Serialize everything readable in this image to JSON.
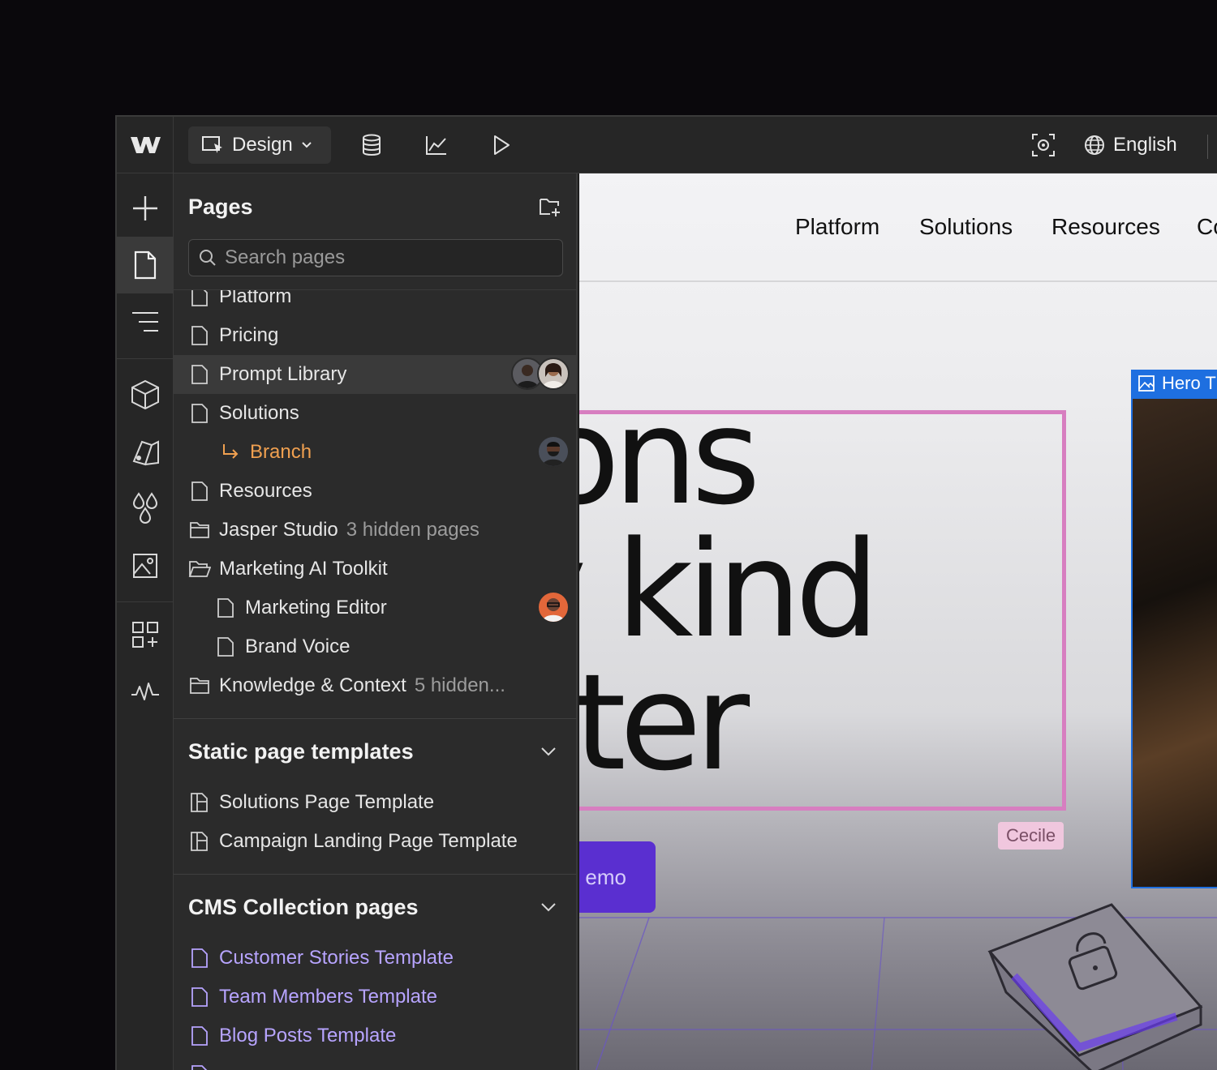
{
  "topbar": {
    "mode_label": "Design",
    "language_label": "English"
  },
  "rail": {
    "items": [
      "add-icon",
      "pages-icon",
      "navigator-icon",
      "components-icon",
      "style-selector-icon",
      "variables-icon",
      "assets-icon",
      "apps-icon",
      "audit-icon"
    ]
  },
  "pages_panel": {
    "title": "Pages",
    "search_placeholder": "Search pages",
    "items": [
      {
        "label": "Platform",
        "icon": "page-icon"
      },
      {
        "label": "Pricing",
        "icon": "page-icon"
      },
      {
        "label": "Prompt Library",
        "icon": "page-icon",
        "highlighted": true
      },
      {
        "label": "Solutions",
        "icon": "page-icon"
      },
      {
        "label": "Branch",
        "icon": "branch-icon"
      },
      {
        "label": "Resources",
        "icon": "page-icon"
      },
      {
        "label": "Jasper Studio",
        "meta": "3 hidden pages",
        "icon": "folder-icon"
      },
      {
        "label": "Marketing AI Toolkit",
        "icon": "folder-open-icon"
      },
      {
        "label": "Marketing Editor",
        "icon": "page-icon"
      },
      {
        "label": "Brand Voice",
        "icon": "page-icon"
      },
      {
        "label": "Knowledge & Context",
        "meta": "5 hidden...",
        "icon": "folder-icon"
      }
    ]
  },
  "static_templates": {
    "title": "Static page templates",
    "items": [
      "Solutions Page Template",
      "Campaign Landing Page Template"
    ]
  },
  "cms_pages": {
    "title": "CMS Collection pages",
    "items": [
      "Customer Stories Template",
      "Team Members Template",
      "Blog Posts Template"
    ]
  },
  "canvas": {
    "nav_links": [
      "Platform",
      "Solutions",
      "Resources",
      "Co"
    ],
    "hero_text": "utions\nery kind\nrketer",
    "cursor_label": "Cecile",
    "cta_label": "emo",
    "image_label": "Hero T"
  },
  "colors": {
    "accent_purple": "#b7a4ff",
    "branch_orange": "#f0a050",
    "selection_pink": "#d77ec0",
    "selection_blue": "#1e6fe0"
  }
}
